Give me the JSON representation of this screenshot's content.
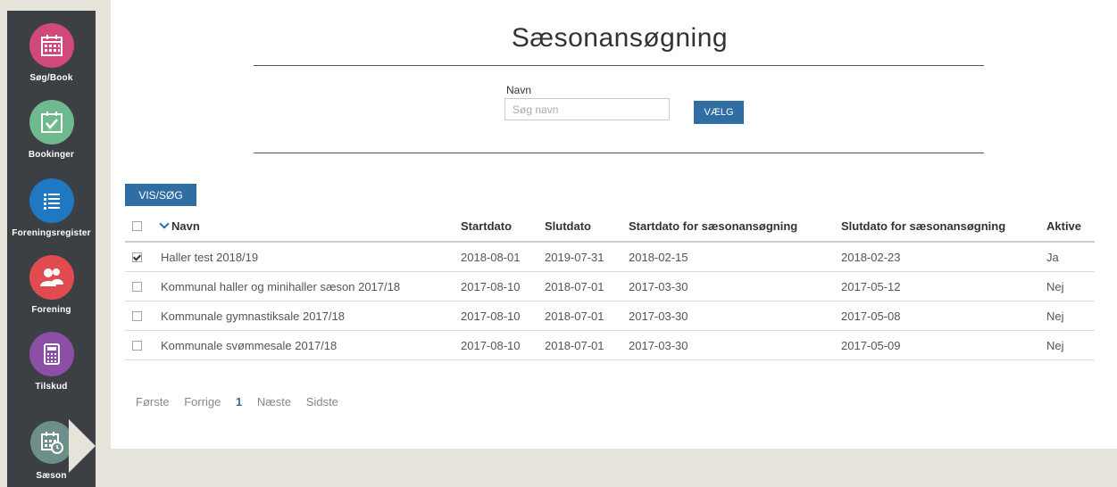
{
  "colors": {
    "sidebar_bg": "#3c3f44",
    "accent_blue": "#2f6da3",
    "nav_search": "#d14979",
    "nav_bookings": "#6fb98f",
    "nav_register": "#1e79c2",
    "nav_association": "#e14a4f",
    "nav_grants": "#8b4fa8",
    "nav_season": "#6d8f8a"
  },
  "sidebar": {
    "items": [
      {
        "label": "Søg/Book",
        "icon": "calendar-grid-icon"
      },
      {
        "label": "Bookinger",
        "icon": "calendar-check-icon"
      },
      {
        "label": "Foreningsregister",
        "icon": "list-icon"
      },
      {
        "label": "Forening",
        "icon": "users-icon"
      },
      {
        "label": "Tilskud",
        "icon": "calculator-icon"
      },
      {
        "label": "Sæson",
        "icon": "calendar-clock-icon"
      }
    ]
  },
  "main": {
    "title": "Sæsonansøgning",
    "search": {
      "label": "Navn",
      "placeholder": "Søg navn",
      "value": "",
      "button": "VÆLG"
    },
    "vis_button": "VIS/SØG",
    "table": {
      "columns": [
        "Navn",
        "Startdato",
        "Slutdato",
        "Startdato for sæsonansøgning",
        "Slutdato for sæsonansøgning",
        "Aktive"
      ],
      "rows": [
        {
          "checked": true,
          "name": "Haller test 2018/19",
          "start": "2018-08-01",
          "end": "2019-07-31",
          "app_start": "2018-02-15",
          "app_end": "2018-02-23",
          "active": "Ja"
        },
        {
          "checked": false,
          "name": "Kommunal haller og minihaller sæson 2017/18",
          "start": "2017-08-10",
          "end": "2018-07-01",
          "app_start": "2017-03-30",
          "app_end": "2017-05-12",
          "active": "Nej"
        },
        {
          "checked": false,
          "name": "Kommunale gymnastiksale 2017/18",
          "start": "2017-08-10",
          "end": "2018-07-01",
          "app_start": "2017-03-30",
          "app_end": "2017-05-08",
          "active": "Nej"
        },
        {
          "checked": false,
          "name": "Kommunale svømmesale 2017/18",
          "start": "2017-08-10",
          "end": "2018-07-01",
          "app_start": "2017-03-30",
          "app_end": "2017-05-09",
          "active": "Nej"
        }
      ]
    },
    "pagination": {
      "first": "Første",
      "prev": "Forrige",
      "current": "1",
      "next": "Næste",
      "last": "Sidste"
    }
  }
}
